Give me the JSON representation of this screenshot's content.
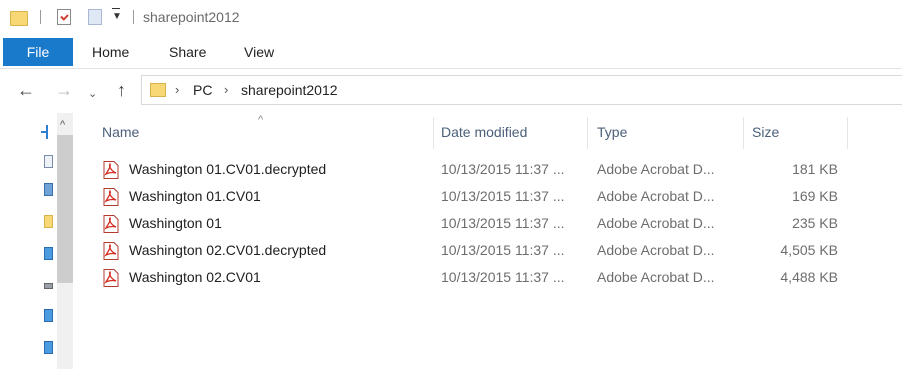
{
  "window": {
    "title": "sharepoint2012",
    "quick_access": [
      "folder-icon",
      "properties-icon",
      "new-folder-icon",
      "customize-dropdown-icon"
    ]
  },
  "ribbon": {
    "tabs": [
      {
        "label": "File",
        "active": true
      },
      {
        "label": "Home"
      },
      {
        "label": "Share"
      },
      {
        "label": "View"
      }
    ],
    "accent_color": "#1979ca"
  },
  "address_bar": {
    "breadcrumbs": [
      "PC",
      "sharepoint2012"
    ]
  },
  "file_list": {
    "columns": [
      "Name",
      "Date modified",
      "Type",
      "Size"
    ],
    "sorted_by": "Name",
    "files": [
      {
        "name": "Washington 01.CV01.decrypted",
        "date": "10/13/2015 11:37 ...",
        "type": "Adobe Acrobat D...",
        "size": "181 KB",
        "icon": "pdf-icon"
      },
      {
        "name": "Washington 01.CV01",
        "date": "10/13/2015 11:37 ...",
        "type": "Adobe Acrobat D...",
        "size": "169 KB",
        "icon": "pdf-icon"
      },
      {
        "name": "Washington 01",
        "date": "10/13/2015 11:37 ...",
        "type": "Adobe Acrobat D...",
        "size": "235 KB",
        "icon": "pdf-icon"
      },
      {
        "name": "Washington 02.CV01.decrypted",
        "date": "10/13/2015 11:37 ...",
        "type": "Adobe Acrobat D...",
        "size": "4,505 KB",
        "icon": "pdf-icon"
      },
      {
        "name": "Washington 02.CV01",
        "date": "10/13/2015 11:37 ...",
        "type": "Adobe Acrobat D...",
        "size": "4,488 KB",
        "icon": "pdf-icon"
      }
    ]
  }
}
